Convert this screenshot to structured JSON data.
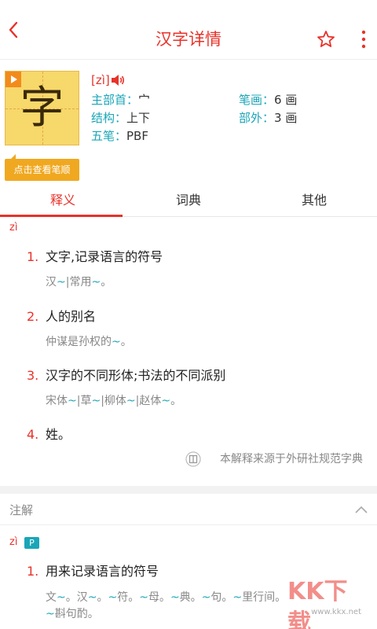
{
  "topbar": {
    "title": "汉字详情",
    "back_icon": "back-arrow-icon",
    "star_icon": "star-icon",
    "more_icon": "more-vertical-icon"
  },
  "char": {
    "glyph": "字",
    "stroke_button": "点击查看笔顺",
    "pinyin": "[zì]",
    "speaker_icon": "speaker-icon"
  },
  "info": {
    "radical_k": "主部首：",
    "radical_v": "宀",
    "strokes_k": "笔画：",
    "strokes_v": "6 画",
    "structure_k": "结构：",
    "structure_v": "上下",
    "outer_k": "部外：",
    "outer_v": "3 画",
    "wubi_k": "五笔：",
    "wubi_v": "PBF"
  },
  "tabs": [
    {
      "label": "释义"
    },
    {
      "label": "词典"
    },
    {
      "label": "其他"
    }
  ],
  "defs": {
    "pinyin": "zì",
    "items": [
      {
        "num": "1.",
        "text": "文字,记录语言的符号",
        "ex": [
          [
            "汉",
            "t"
          ],
          [
            "~",
            "b"
          ],
          [
            "|常用",
            "t"
          ],
          [
            "~",
            "b"
          ],
          [
            "。",
            "t"
          ]
        ]
      },
      {
        "num": "2.",
        "text": "人的别名",
        "ex": [
          [
            "仲谋是孙权的",
            "t"
          ],
          [
            "~",
            "b"
          ],
          [
            "。",
            "t"
          ]
        ]
      },
      {
        "num": "3.",
        "text": "汉字的不同形体;书法的不同派别",
        "ex": [
          [
            "宋体",
            "t"
          ],
          [
            "~",
            "b"
          ],
          [
            "|草",
            "t"
          ],
          [
            "~",
            "b"
          ],
          [
            "|柳体",
            "t"
          ],
          [
            "~",
            "b"
          ],
          [
            "|赵体",
            "t"
          ],
          [
            "~",
            "b"
          ],
          [
            "。",
            "t"
          ]
        ]
      },
      {
        "num": "4.",
        "text": "姓。"
      }
    ],
    "source": "本解释来源于外研社规范字典",
    "source_icon": "book-icon"
  },
  "notes": {
    "label": "注解",
    "chevron_icon": "chevron-up-icon",
    "pinyin": "zì",
    "badge": "P",
    "item_num": "1.",
    "item_text": "用来记录语言的符号",
    "ex_line1": [
      [
        "文",
        "t"
      ],
      [
        "~",
        "b"
      ],
      [
        "。汉",
        "t"
      ],
      [
        "~",
        "b"
      ],
      [
        "。",
        "t"
      ],
      [
        "~",
        "b"
      ],
      [
        "符。",
        "t"
      ],
      [
        "~",
        "b"
      ],
      [
        "母。",
        "t"
      ],
      [
        "~",
        "b"
      ],
      [
        "典。",
        "t"
      ],
      [
        "~",
        "b"
      ],
      [
        "句。",
        "t"
      ],
      [
        "~",
        "b"
      ],
      [
        "里行",
        "t"
      ],
      [
        "间。",
        "t"
      ]
    ],
    "ex_line2": [
      [
        "~",
        "b"
      ],
      [
        "斟句酌。",
        "t"
      ]
    ]
  },
  "watermark": {
    "text": "KK下载",
    "url": "www.kkx.net"
  },
  "colors": {
    "accent": "#e8322a",
    "teal": "#1aa6b7",
    "tile": "#f7d86a",
    "button": "#f0a820"
  }
}
